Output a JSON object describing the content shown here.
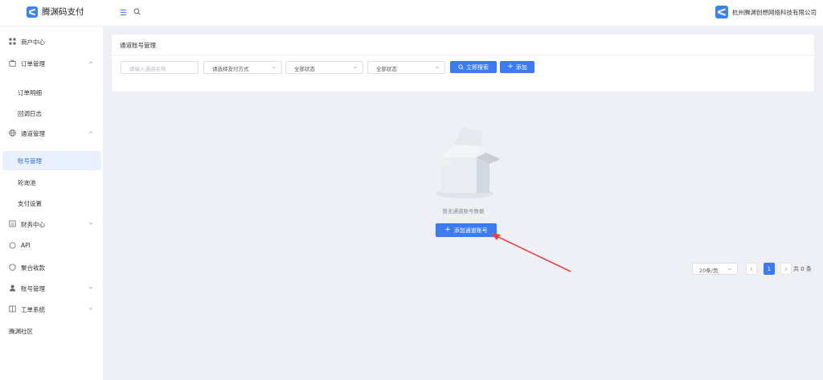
{
  "app": {
    "name": "腾渊码支付",
    "company": "杭州腾渊创想网络科技有限公司"
  },
  "colors": {
    "accent": "#3b7af0",
    "active_bg": "#eaf1fe",
    "page_bg": "#eef0f6",
    "arrow": "#e8443a"
  },
  "sidebar": {
    "items": [
      {
        "label": "商户中心",
        "icon": "grid-icon"
      },
      {
        "label": "订单管理",
        "icon": "bag-icon",
        "chevron": "chevron-up-icon"
      },
      {
        "label": "订单明细"
      },
      {
        "label": "回调日志"
      },
      {
        "label": "通道管理",
        "icon": "globe-icon",
        "chevron": "chevron-up-icon"
      },
      {
        "label": "账号管理",
        "active": true
      },
      {
        "label": "轮询池"
      },
      {
        "label": "支付设置"
      },
      {
        "label": "财务中心",
        "icon": "finance-icon",
        "chevron": "chevron-down-icon"
      },
      {
        "label": "API",
        "icon": "api-icon"
      },
      {
        "label": "聚合收款",
        "icon": "collect-icon"
      },
      {
        "label": "账号管理",
        "icon": "user-icon",
        "chevron": "chevron-down-icon"
      },
      {
        "label": "工单系统",
        "icon": "book-icon",
        "chevron": "chevron-down-icon"
      },
      {
        "label": "腾渊社区"
      }
    ]
  },
  "panel": {
    "title": "通道账号管理",
    "filters": {
      "name_placeholder": "请输入通道名称",
      "pay_method": "请选择支付方式",
      "status1": "全部状态",
      "status2": "全部状态"
    },
    "search_label": "立即搜索",
    "add_label": "添加"
  },
  "empty": {
    "text": "暂无通道账号数据",
    "add_label": "添加通道账号"
  },
  "pagination": {
    "page_size": "20条/页",
    "current_page": "1",
    "total": "共 0 条"
  }
}
